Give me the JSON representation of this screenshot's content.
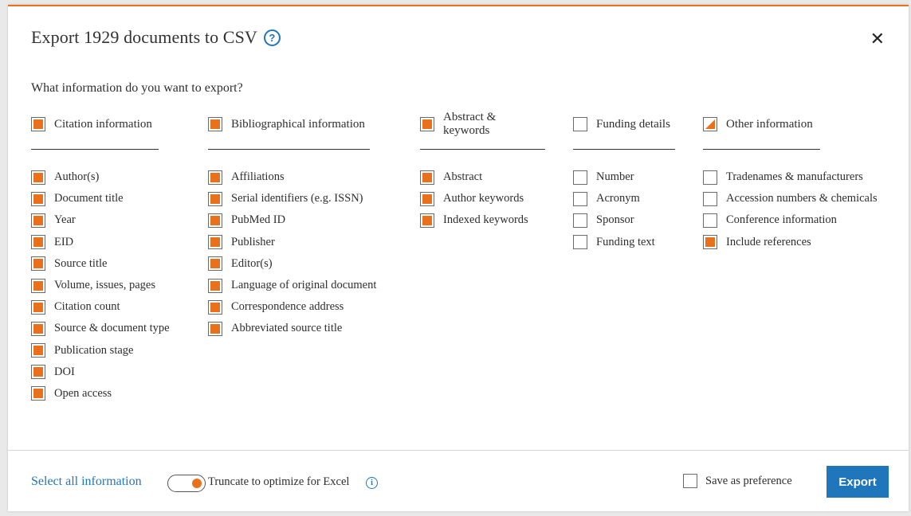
{
  "dialog": {
    "title": "Export 1929 documents to CSV",
    "question": "What information do you want to export?"
  },
  "columns": [
    {
      "header": "Citation information",
      "state": "checked",
      "items": [
        {
          "label": "Author(s)",
          "checked": true
        },
        {
          "label": "Document title",
          "checked": true
        },
        {
          "label": "Year",
          "checked": true
        },
        {
          "label": "EID",
          "checked": true
        },
        {
          "label": "Source title",
          "checked": true
        },
        {
          "label": "Volume, issues, pages",
          "checked": true
        },
        {
          "label": "Citation count",
          "checked": true
        },
        {
          "label": "Source & document type",
          "checked": true
        },
        {
          "label": "Publication stage",
          "checked": true
        },
        {
          "label": "DOI",
          "checked": true
        },
        {
          "label": "Open access",
          "checked": true
        }
      ]
    },
    {
      "header": "Bibliographical information",
      "state": "checked",
      "items": [
        {
          "label": "Affiliations",
          "checked": true
        },
        {
          "label": "Serial identifiers (e.g. ISSN)",
          "checked": true
        },
        {
          "label": "PubMed ID",
          "checked": true
        },
        {
          "label": "Publisher",
          "checked": true
        },
        {
          "label": "Editor(s)",
          "checked": true
        },
        {
          "label": "Language of original document",
          "checked": true
        },
        {
          "label": "Correspondence address",
          "checked": true
        },
        {
          "label": "Abbreviated source title",
          "checked": true
        }
      ]
    },
    {
      "header": "Abstract & keywords",
      "state": "checked",
      "items": [
        {
          "label": "Abstract",
          "checked": true
        },
        {
          "label": "Author keywords",
          "checked": true
        },
        {
          "label": "Indexed keywords",
          "checked": true
        }
      ]
    },
    {
      "header": "Funding details",
      "state": "unchecked",
      "items": [
        {
          "label": "Number",
          "checked": false
        },
        {
          "label": "Acronym",
          "checked": false
        },
        {
          "label": "Sponsor",
          "checked": false
        },
        {
          "label": "Funding text",
          "checked": false
        }
      ]
    },
    {
      "header": "Other information",
      "state": "partial",
      "items": [
        {
          "label": "Tradenames & manufacturers",
          "checked": false
        },
        {
          "label": "Accession numbers & chemicals",
          "checked": false
        },
        {
          "label": "Conference information",
          "checked": false
        },
        {
          "label": "Include references",
          "checked": true
        }
      ]
    }
  ],
  "footer": {
    "select_all": "Select all information",
    "truncate_label": "Truncate to optimize for Excel",
    "truncate_on": true,
    "save_pref_label": "Save as preference",
    "save_pref_checked": false,
    "export_label": "Export"
  },
  "colors": {
    "accent": "#e9711c",
    "link": "#1f76bb"
  },
  "icons": {
    "help": "question-circle-icon",
    "close": "close-icon",
    "info": "info-circle-icon"
  }
}
